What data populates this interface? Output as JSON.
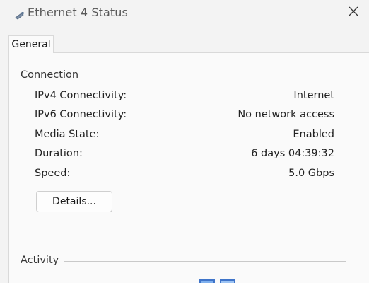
{
  "window": {
    "title": "Ethernet 4 Status",
    "title_icon": "ethernet-icon",
    "close_icon": "close-icon"
  },
  "tabs": [
    {
      "label": "General",
      "selected": true
    }
  ],
  "connection": {
    "heading": "Connection",
    "rows": [
      {
        "label": "IPv4 Connectivity:",
        "value": "Internet"
      },
      {
        "label": "IPv6 Connectivity:",
        "value": "No network access"
      },
      {
        "label": "Media State:",
        "value": "Enabled"
      },
      {
        "label": "Duration:",
        "value": "6 days 04:39:32"
      },
      {
        "label": "Speed:",
        "value": "5.0 Gbps"
      }
    ],
    "details_button": "Details..."
  },
  "activity": {
    "heading": "Activity",
    "icon": "network-computers-icon"
  },
  "colors": {
    "background": "#f3f3f3",
    "panel": "#fafafa",
    "border": "#d9d9d9"
  }
}
